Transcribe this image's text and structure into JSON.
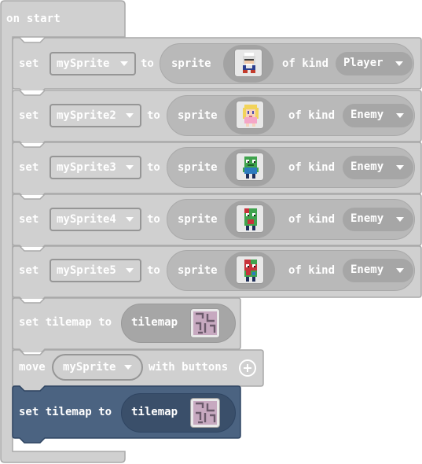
{
  "hat": {
    "label": "on start"
  },
  "set_sprite_blocks": [
    {
      "set": "set",
      "variable": "mySprite",
      "to": "to",
      "sprite": "sprite",
      "of_kind": "of kind",
      "kind": "Player",
      "sprite_icon": "old-man-player-sprite"
    },
    {
      "set": "set",
      "variable": "mySprite2",
      "to": "to",
      "sprite": "sprite",
      "of_kind": "of kind",
      "kind": "Enemy",
      "sprite_icon": "blonde-girl-sprite"
    },
    {
      "set": "set",
      "variable": "mySprite3",
      "to": "to",
      "sprite": "sprite",
      "of_kind": "of kind",
      "kind": "Enemy",
      "sprite_icon": "green-zombie-sprite"
    },
    {
      "set": "set",
      "variable": "mySprite4",
      "to": "to",
      "sprite": "sprite",
      "of_kind": "of kind",
      "kind": "Enemy",
      "sprite_icon": "green-red-zombie-sprite"
    },
    {
      "set": "set",
      "variable": "mySprite5",
      "to": "to",
      "sprite": "sprite",
      "of_kind": "of kind",
      "kind": "Enemy",
      "sprite_icon": "red-zombie-sprite"
    }
  ],
  "tilemap_block_1": {
    "label": "set tilemap to",
    "value": "tilemap"
  },
  "move_block": {
    "move": "move",
    "variable": "mySprite",
    "with_buttons": "with buttons"
  },
  "tilemap_block_2": {
    "label": "set tilemap to",
    "value": "tilemap"
  },
  "colors": {
    "block_gray": "#d0d0d0",
    "block_border": "#a9a9a9",
    "selected_block": "#4b6381",
    "selected_border": "#2f4562",
    "reporter_gray": "#b9b9b9",
    "kind_pill": "#a6a6a6"
  }
}
